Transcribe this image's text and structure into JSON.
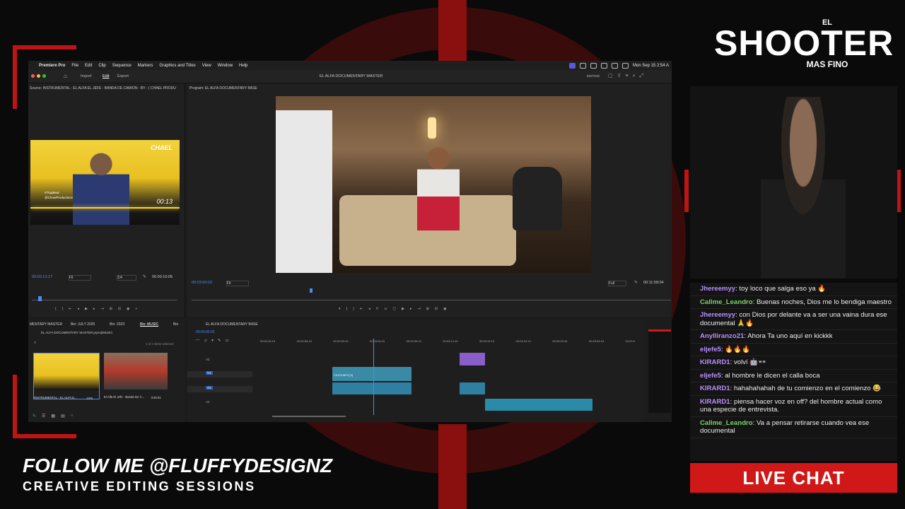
{
  "menubar": {
    "app": "Premiere Pro",
    "items": [
      "File",
      "Edit",
      "Clip",
      "Sequence",
      "Markers",
      "Graphics and Titles",
      "View",
      "Window",
      "Help"
    ],
    "clock": "Mon Sep 15  2:54 A"
  },
  "window": {
    "tabs": [
      "Import",
      "Edit",
      "Export"
    ],
    "title": "EL ALFA DOCUMENTARY MASTER",
    "workspace": "EDITING"
  },
  "source_monitor": {
    "tab": "Source: INSTRUMENTAL - EL ALFA EL JEFE - BANDA DE CAMION - BY - ( CHAEL PRODU",
    "timecode": "00:00:13:17",
    "fit": "Fit",
    "ratio": "1/4",
    "duration": "00:00:10:05",
    "thumb_logo": "CHAEL",
    "thumb_tag1": "#TrapBeat",
    "thumb_tag2": "@ChaelProductions",
    "thumb_time": "00:13"
  },
  "program_monitor": {
    "tab": "Program: EL ALFA DOCUMENTARY BASE",
    "timecode": "00:03:00:02",
    "fit": "Fit",
    "quality": "Full",
    "duration": "00:11:58:04"
  },
  "project": {
    "tabs": [
      "MENTARY MASTER",
      "Bin: JULY 2025",
      "Bin: 2023",
      "Bin: MUSIC",
      "Bin"
    ],
    "path": "EL ALFA DOCUMENTARY MASTER.prproj\\MUSIC",
    "selected": "1 of 2 items selected",
    "items": [
      {
        "name": "INSTRUMENTAL - EL ALFA E...",
        "dur": "3:03"
      },
      {
        "name": "El Alfa El Jefe - Banda De C...",
        "dur": "3:26:01"
      }
    ]
  },
  "timeline": {
    "tab": "EL ALFA DOCUMENTARY BASE",
    "timecode": "00:03:00:02",
    "ruler": [
      "00:02:49:19",
      "00:02:54:19",
      "00:02:59:19",
      "00:03:04:19",
      "00:03:09:19",
      "00:03:14:19",
      "00:03:19:19",
      "00:03:24:19",
      "00:03:29:18",
      "00:03:34:18",
      "00:03:3"
    ],
    "tracks": [
      "V2",
      "V1",
      "A1",
      "A2"
    ],
    "clip_label": "C0123.MP4 [V]"
  },
  "chat": {
    "messages": [
      {
        "user": "Jhereemyy",
        "color": "#b98fff",
        "text": "toy loco que salga eso ya 🔥"
      },
      {
        "user": "Callme_Leandro",
        "color": "#7bd36b",
        "text": "Buenas noches, Dios me lo bendiga maestro"
      },
      {
        "user": "Jhereemyy",
        "color": "#b98fff",
        "text": "con Dios por delante va a ser una vaina dura ese documental 🙏🔥"
      },
      {
        "user": "Anylliranzo21",
        "color": "#b98fff",
        "text": "Ahora Ta uno aquí en kickkk"
      },
      {
        "user": "eljefe5",
        "color": "#b98fff",
        "text": "🔥🔥🔥"
      },
      {
        "user": "KIRARD1",
        "color": "#b98fff",
        "text": "volví 🤖👓"
      },
      {
        "user": "eljefe5",
        "color": "#b98fff",
        "text": "al hombre le dicen el calla boca"
      },
      {
        "user": "KIRARD1",
        "color": "#b98fff",
        "text": "hahahahahah de tu comienzo en el comienzo 😂"
      },
      {
        "user": "KIRARD1",
        "color": "#b98fff",
        "text": "piensa hacer voz en off? del hombre actual como una especie de entrevista."
      },
      {
        "user": "Callme_Leandro",
        "color": "#7bd36b",
        "text": "Va a pensar retirarse cuando vea ese documental"
      }
    ]
  },
  "overlay": {
    "logo_top": "EL",
    "logo_main": "SHOOTER",
    "logo_sub": "MAS FINO",
    "live_chat": "LIVE CHAT",
    "follow": "FOLLOW ME @FLUFFYDESIGNZ",
    "sessions": "CREATIVE EDITING SESSIONS",
    "accent": "#d01818"
  }
}
